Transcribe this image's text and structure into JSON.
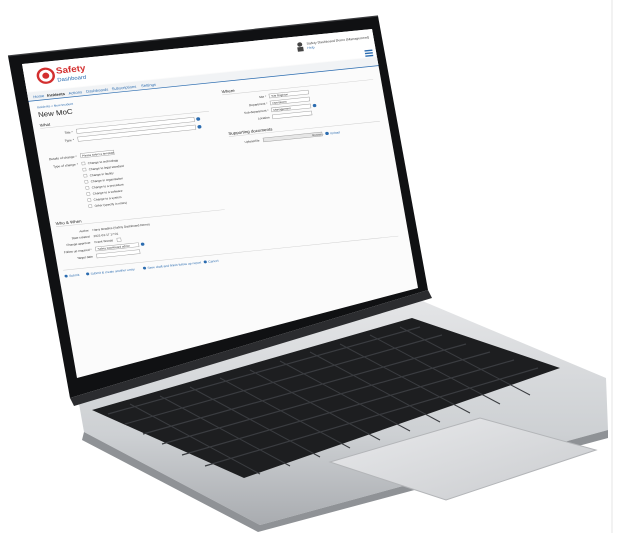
{
  "app": {
    "logo_line1": "Safety",
    "logo_line2": "Dashboard",
    "user_name": "Safety Dashboard Demo (Management)",
    "user_sub": "Help"
  },
  "nav": [
    "Home",
    "Incidents",
    "Actions",
    "Dashboards",
    "Subscriptions",
    "Settings"
  ],
  "breadcrumb": "Incidents » New Incident",
  "page_title": "New MoC",
  "sections": {
    "what": "What",
    "where": "Where",
    "who_when": "Who & When",
    "supporting_documents": "Supporting documents"
  },
  "what_fields": {
    "title_label": "Title *",
    "type_label": "Type *",
    "details_label": "Details of change *",
    "type_of_change_label": "Type of change *",
    "details_value": "Please select a template"
  },
  "change_types": [
    "Change to technology",
    "Change to legal standard",
    "Change in facility",
    "Change in organization",
    "Change to a procedure",
    "Change to a software",
    "Change to a system",
    "Other (specify in notes)"
  ],
  "where_fields": {
    "site_label": "Site *",
    "site_value": "Site Brighton",
    "department_label": "Department *",
    "department_value": "Operations",
    "sub_department_label": "Sub-department *",
    "sub_department_value": "Management",
    "location_label": "Location"
  },
  "documents": {
    "upload_label": "Upload file",
    "browse_label": "Browse…",
    "upload_button": "Upload"
  },
  "who_fields": {
    "author_label": "Author",
    "author_value": "Harry Beadles (Safety Dashboard Demo)",
    "date_label": "Date created",
    "date_value": "2021-03-17 17:01",
    "approver_label": "Change approver",
    "approver_value": "Frank Woods",
    "follow_up_label": "Follow up required *",
    "follow_up_value": "Safety Dashboard admin",
    "target_label": "Target date"
  },
  "actions": {
    "submit": "Submit",
    "submit_new": "Submit & create another entry",
    "save_later": "Save draft and finish follow up report",
    "cancel": "Cancel"
  },
  "colors": {
    "logo_red": "#d32f2f",
    "accent_blue": "#2b6cb0",
    "laptop_silver": "#cfd1d4",
    "keyboard_black": "#1d1e20",
    "bezel": "#101113"
  }
}
